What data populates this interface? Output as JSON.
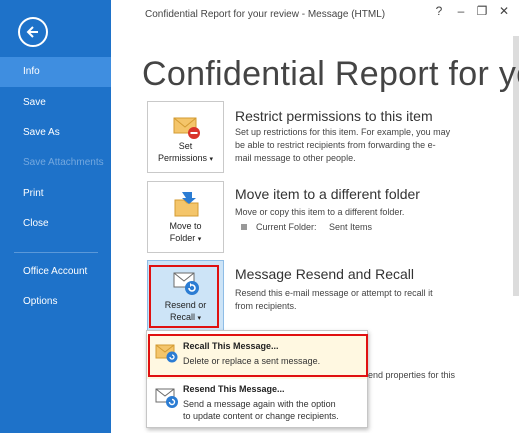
{
  "window": {
    "title": "Confidential Report for your review - Message (HTML)",
    "help": "?",
    "minimize": "–",
    "restore": "❐",
    "close": "✕"
  },
  "sidebar": {
    "items": [
      "Info",
      "Save",
      "Save As",
      "Save Attachments",
      "Print",
      "Close",
      "Office Account",
      "Options"
    ]
  },
  "page_title": "Confidential Report for yo",
  "permissions": {
    "button_line1": "Set",
    "button_line2": "Permissions",
    "title": "Restrict permissions to this item",
    "desc1": "Set up restrictions for this item. For example, you may",
    "desc2": "be able to restrict recipients from forwarding the e-",
    "desc3": "mail message to other people."
  },
  "move": {
    "button_line1": "Move to",
    "button_line2": "Folder",
    "title": "Move item to a different folder",
    "desc": "Move or copy this item to a different folder.",
    "folder_label": "Current Folder:",
    "folder_value": "Sent Items"
  },
  "resend": {
    "button_line1": "Resend or",
    "button_line2": "Recall",
    "title": "Message Resend and Recall",
    "desc1": "Resend this e-mail message or attempt to recall it",
    "desc2": "from recipients."
  },
  "behind_text": "end properties for this",
  "dropdown": {
    "recall_title": "Recall This Message...",
    "recall_desc": "Delete or replace a sent message.",
    "resend_title": "Resend This Message...",
    "resend_desc1": "Send a message again with the option",
    "resend_desc2": "to update content or change recipients."
  },
  "colors": {
    "sidebar": "#1e72c9",
    "sidebar_active": "#3f8ee0",
    "highlight": "#e01010"
  }
}
